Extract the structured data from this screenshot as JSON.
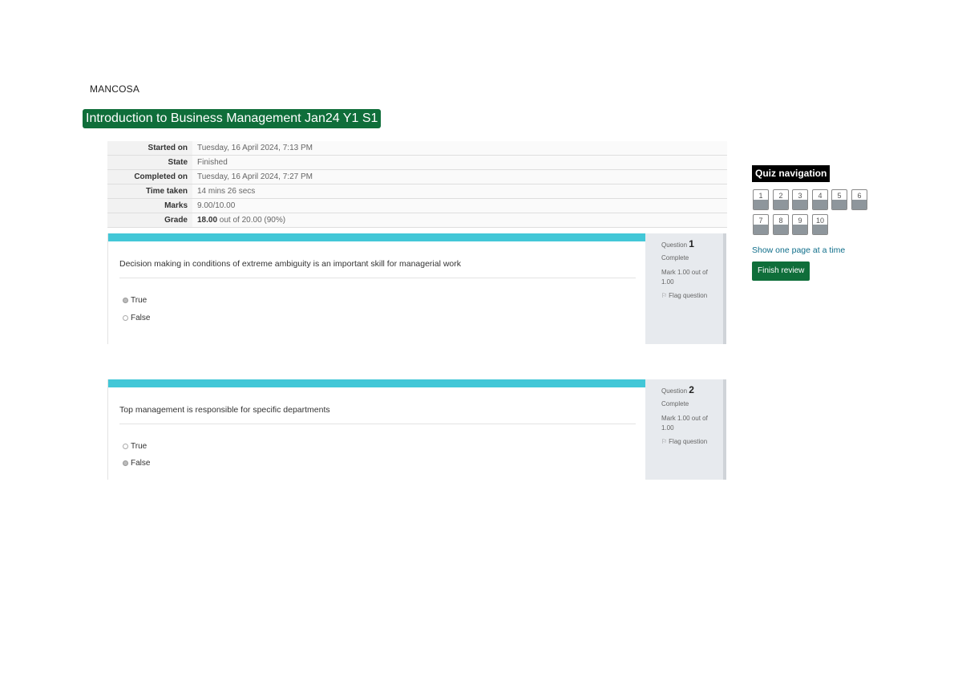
{
  "site": {
    "brand": "MANCOSA"
  },
  "course": {
    "title": "Introduction to Business Management Jan24 Y1 S1"
  },
  "summary": {
    "rows": [
      {
        "label": "Started on",
        "value": "Tuesday, 16 April 2024, 7:13 PM"
      },
      {
        "label": "State",
        "value": "Finished"
      },
      {
        "label": "Completed on",
        "value": "Tuesday, 16 April 2024, 7:27 PM"
      },
      {
        "label": "Time taken",
        "value": "14 mins 26 secs"
      },
      {
        "label": "Marks",
        "value": "9.00/10.00"
      }
    ],
    "grade": {
      "label": "Grade",
      "value_bold": "18.00",
      "value_rest": " out of 20.00 (90%)"
    }
  },
  "questions": [
    {
      "prefix": "Question ",
      "number": "1",
      "state": "Complete",
      "mark": "Mark 1.00 out of 1.00",
      "flag": "Flag question",
      "text": "Decision making in conditions of extreme ambiguity is an important skill for managerial work",
      "answers": [
        {
          "label": "True",
          "checked": true
        },
        {
          "label": "False",
          "checked": false
        }
      ]
    },
    {
      "prefix": "Question ",
      "number": "2",
      "state": "Complete",
      "mark": "Mark 1.00 out of 1.00",
      "flag": "Flag question",
      "text": "Top management is responsible for specific departments",
      "answers": [
        {
          "label": "True",
          "checked": false
        },
        {
          "label": "False",
          "checked": true
        }
      ]
    }
  ],
  "nav": {
    "title": "Quiz navigation",
    "buttons": [
      "1",
      "2",
      "3",
      "4",
      "5",
      "6",
      "7",
      "8",
      "9",
      "10"
    ],
    "show_one_page": "Show one page at a time",
    "finish_review": "Finish review"
  }
}
